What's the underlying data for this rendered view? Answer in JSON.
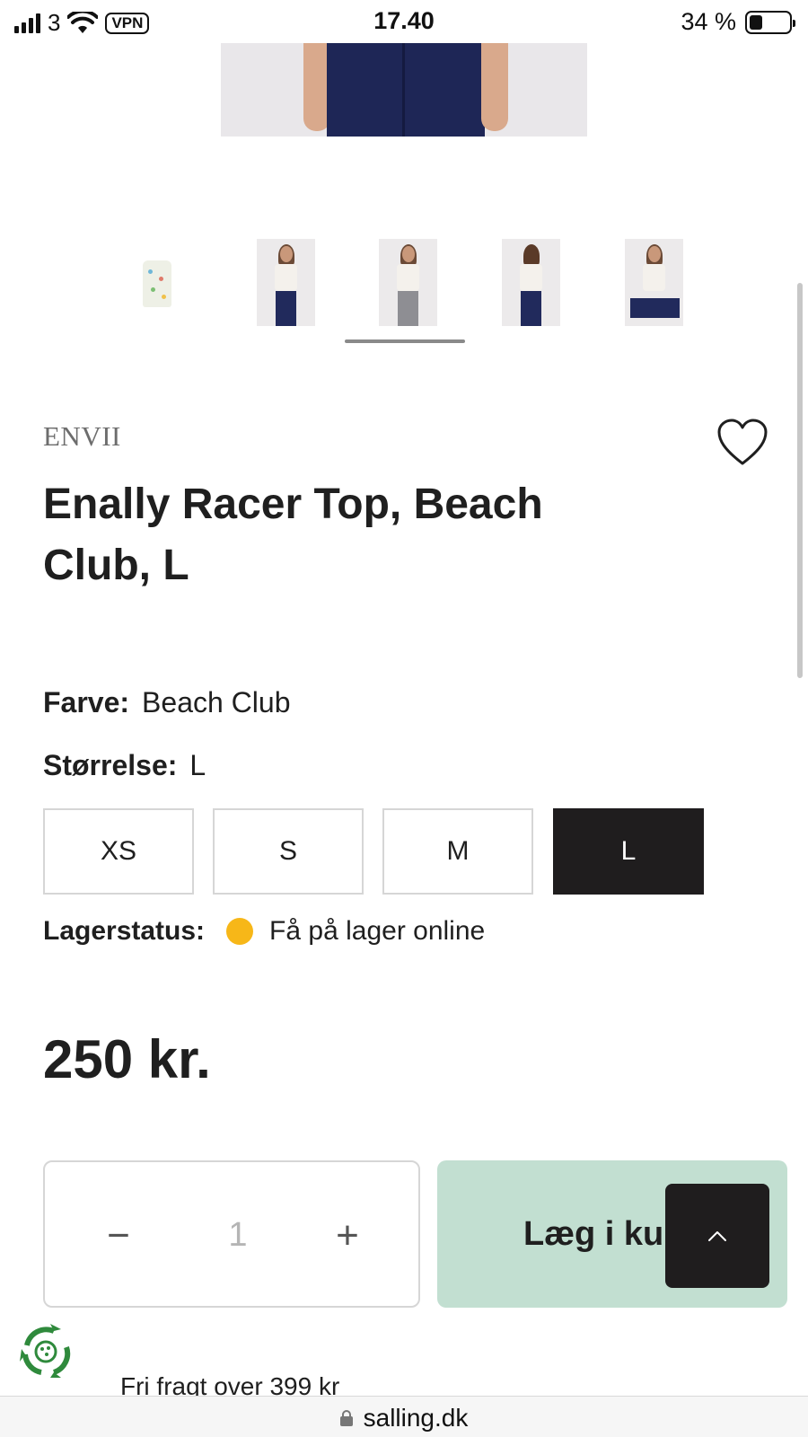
{
  "status_bar": {
    "carrier": "3",
    "vpn": "VPN",
    "time": "17.40",
    "battery_percent": "34 %",
    "battery_level": 0.34
  },
  "product": {
    "brand": "ENVII",
    "title": "Enally Racer Top, Beach Club, L",
    "color_label": "Farve:",
    "color_value": "Beach Club",
    "size_label": "Størrelse:",
    "size_value": "L",
    "sizes": [
      {
        "label": "XS",
        "selected": false
      },
      {
        "label": "S",
        "selected": false
      },
      {
        "label": "M",
        "selected": false
      },
      {
        "label": "L",
        "selected": true
      }
    ],
    "stock_label": "Lagerstatus:",
    "stock_text": "Få på lager online",
    "stock_color": "#f7b718",
    "price": "250 kr."
  },
  "gallery": {
    "thumbnail_count": 5,
    "active_index": 2
  },
  "cart": {
    "quantity": "1",
    "minus_symbol": "−",
    "plus_symbol": "+",
    "add_label": "Læg i ku",
    "add_color": "#c2dfd1"
  },
  "shipping_text": "Fri fragt over 399 kr",
  "url": "salling.dk"
}
